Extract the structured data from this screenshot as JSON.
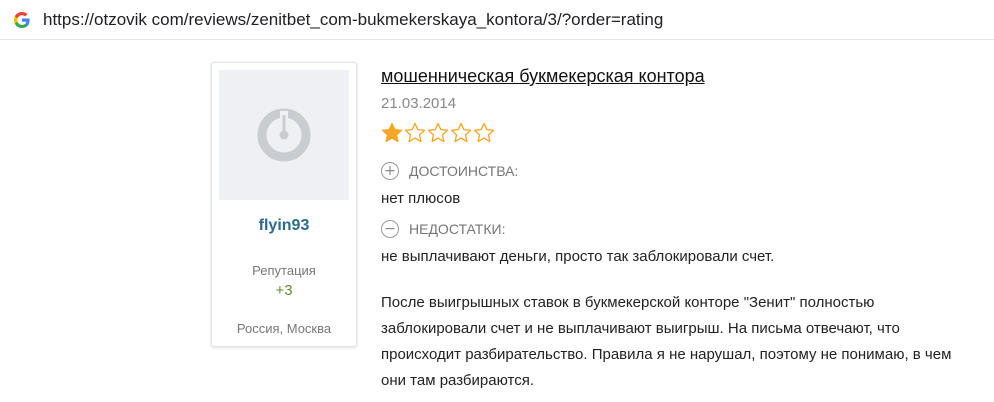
{
  "browser": {
    "url": "https://otzovik com/reviews/zenitbet_com-bukmekerskaya_kontora/3/?order=rating"
  },
  "author": {
    "name": "flyin93",
    "reputation_label": "Репутация",
    "reputation_value": "+3",
    "location": "Россия, Москва"
  },
  "review": {
    "title": "мошенническая букмекерская контора",
    "date": "21.03.2014",
    "rating": 1,
    "rating_max": 5,
    "pros_label": "ДОСТОИНСТВА:",
    "pros_text": "нет плюсов",
    "cons_label": "НЕДОСТАТКИ:",
    "cons_text": "не выплачивают деньги, просто так заблокировали счет.",
    "body": "После выигрышных ставок в букмекерской конторе \"Зенит\" полностью заблокировали счет и не выплачивают выигрыш. На письма отвечают, что происходит разбирательство. Правила я не нарушал, поэтому не понимаю, в чем они там разбираются."
  },
  "colors": {
    "star_filled": "#f5a623",
    "star_empty_stroke": "#f5a623",
    "username": "#2d6b8c",
    "reputation": "#5c8f2e"
  }
}
